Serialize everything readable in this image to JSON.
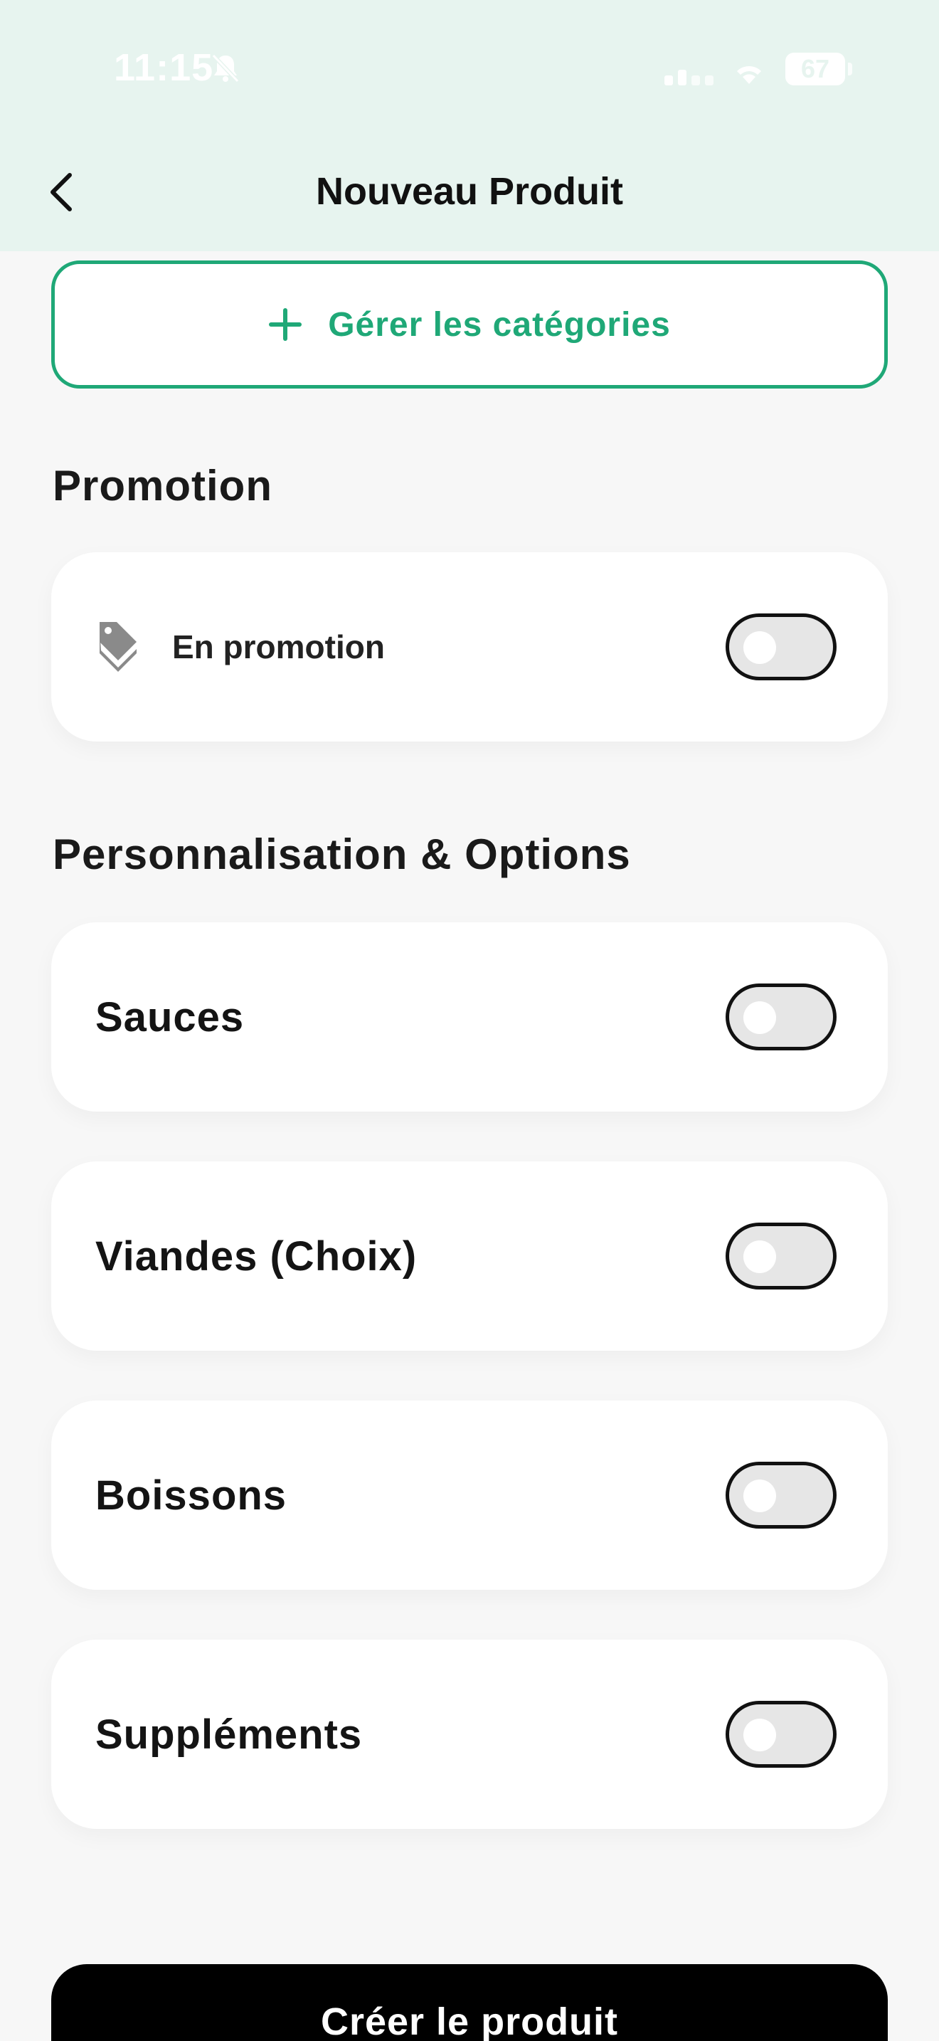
{
  "status_bar": {
    "time": "11:15",
    "battery": "67"
  },
  "header": {
    "title": "Nouveau Produit"
  },
  "manage_categories": {
    "label": "Gérer les catégories"
  },
  "promotion": {
    "title": "Promotion",
    "item": {
      "label": "En promotion",
      "enabled": false
    }
  },
  "options": {
    "title": "Personnalisation & Options",
    "items": [
      {
        "label": "Sauces",
        "enabled": false
      },
      {
        "label": "Viandes (Choix)",
        "enabled": false
      },
      {
        "label": "Boissons",
        "enabled": false
      },
      {
        "label": "Suppléments",
        "enabled": false
      }
    ]
  },
  "create_button": {
    "label": "Créer le produit"
  },
  "colors": {
    "accent": "#1fa877",
    "header_bg": "#e7f4ef",
    "primary_button": "#000000"
  }
}
